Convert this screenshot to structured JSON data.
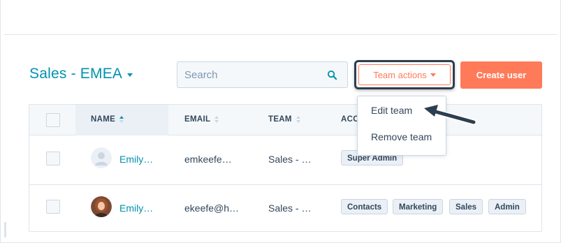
{
  "header": {
    "team_name": "Sales - EMEA"
  },
  "search": {
    "placeholder": "Search"
  },
  "actions": {
    "team_actions_label": "Team actions",
    "create_user_label": "Create user"
  },
  "dropdown": {
    "items": [
      "Edit team",
      "Remove team"
    ]
  },
  "table": {
    "columns": [
      "NAME",
      "EMAIL",
      "TEAM",
      "ACC"
    ],
    "sorted_column": "NAME",
    "rows": [
      {
        "name": "Emily…",
        "email": "emkeefe…",
        "team": "Sales - …",
        "access": [
          "Super Admin"
        ],
        "avatar": "placeholder-avatar"
      },
      {
        "name": "Emily…",
        "email": "ekeefe@h…",
        "team": "Sales - …",
        "access": [
          "Contacts",
          "Marketing",
          "Sales",
          "Admin"
        ],
        "avatar": "photo-avatar"
      }
    ]
  },
  "colors": {
    "accent_teal": "#0091ae",
    "brand_orange": "#ff7a59",
    "text_dark": "#33475b",
    "annotation_navy": "#2d3e50"
  }
}
